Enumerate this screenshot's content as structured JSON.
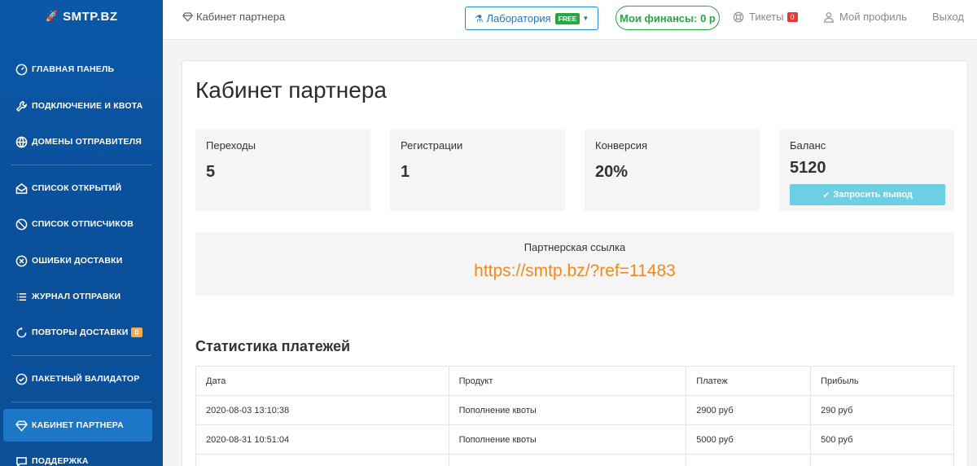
{
  "brand": {
    "name": "SMTP.BZ"
  },
  "sidebar": {
    "items": [
      {
        "label": "Главная панель",
        "icon": "gauge-icon"
      },
      {
        "label": "Подключение и квота",
        "icon": "wrench-icon"
      },
      {
        "label": "Домены отправителя",
        "icon": "globe-icon"
      },
      {
        "label": "Список открытий",
        "icon": "envelope-open-icon"
      },
      {
        "label": "Список отписчиков",
        "icon": "ban-icon"
      },
      {
        "label": "Ошибки доставки",
        "icon": "x-circle-icon"
      },
      {
        "label": "Журнал отправки",
        "icon": "list-icon"
      },
      {
        "label": "Повторы доставки",
        "icon": "refresh-icon",
        "badge": "0"
      },
      {
        "label": "Пакетный валидатор",
        "icon": "check-circle-icon"
      },
      {
        "label": "Кабинет партнера",
        "icon": "diamond-icon",
        "active": true
      },
      {
        "label": "Поддержка",
        "icon": "chat-icon"
      }
    ]
  },
  "header": {
    "breadcrumb": "Кабинет партнера",
    "lab_label": "Лаборатория",
    "lab_badge": "FREE",
    "finance_label": "Мои финансы: 0 р",
    "tickets_label": "Тикеты",
    "tickets_badge": "0",
    "profile_label": "Мой профиль",
    "logout_label": "Выход"
  },
  "main": {
    "title": "Кабинет партнера",
    "stats": [
      {
        "label": "Переходы",
        "value": "5"
      },
      {
        "label": "Регистрации",
        "value": "1"
      },
      {
        "label": "Конверсия",
        "value": "20%"
      },
      {
        "label": "Баланс",
        "value": "5120"
      }
    ],
    "withdraw_label": "Запросить вывод",
    "ref_label": "Партнерская ссылка",
    "ref_link": "https://smtp.bz/?ref=11483",
    "payments_title": "Статистика платежей",
    "table": {
      "headers": [
        "Дата",
        "Продукт",
        "Платеж",
        "Прибыль"
      ],
      "rows": [
        [
          "2020-08-03 13:10:38",
          "Пополнение квоты",
          "2900 руб",
          "290 руб"
        ],
        [
          "2020-08-31 10:51:04",
          "Пополнение квоты",
          "5000 руб",
          "500 руб"
        ]
      ]
    }
  },
  "colors": {
    "sidebar": "#0b58a8",
    "active": "#1c77c8",
    "accent_orange": "#f08a1c",
    "green": "#28a745",
    "teal_button": "#6ccfe3"
  }
}
